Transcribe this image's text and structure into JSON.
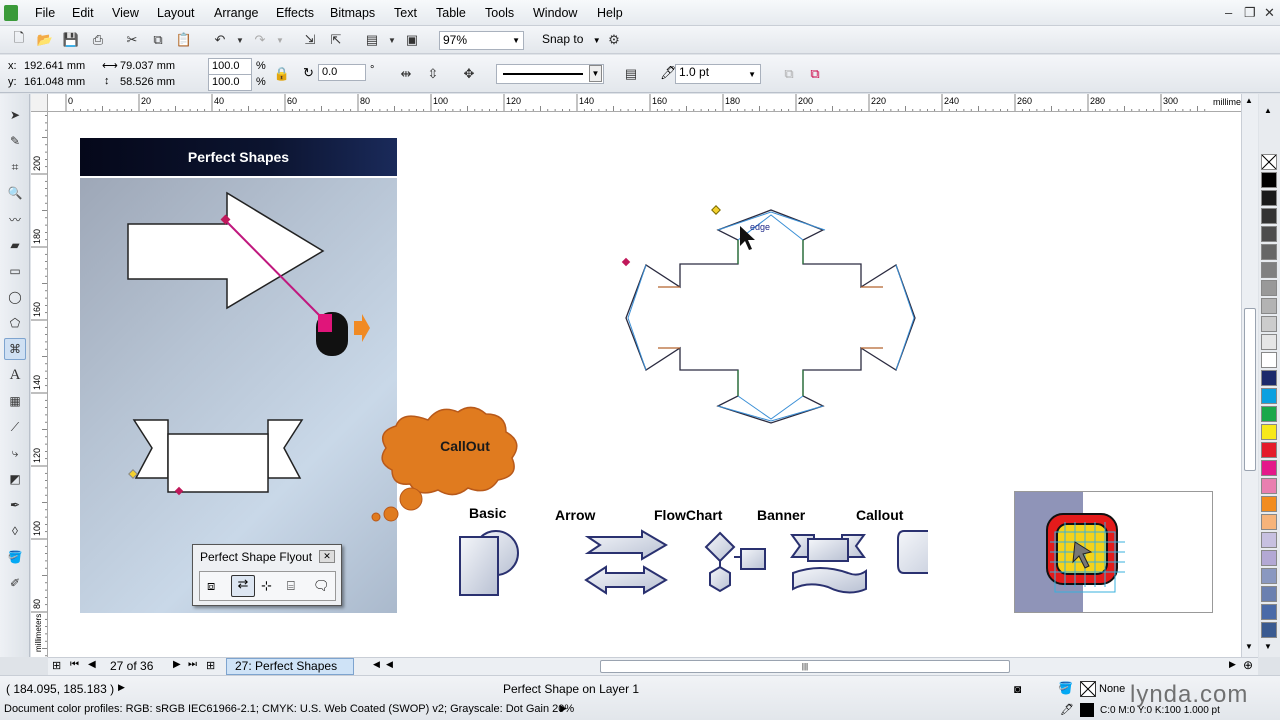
{
  "menu": {
    "items": [
      "File",
      "Edit",
      "View",
      "Layout",
      "Arrange",
      "Effects",
      "Bitmaps",
      "Text",
      "Table",
      "Tools",
      "Window",
      "Help"
    ]
  },
  "standard_toolbar": {
    "zoom": "97%",
    "snap_to": "Snap to"
  },
  "property_bar": {
    "x": "192.641 mm",
    "y": "161.048 mm",
    "width": "79.037 mm",
    "height": "58.526 mm",
    "scale_x": "100.0",
    "scale_y": "100.0",
    "percent": "%",
    "rotation": "0.0",
    "degree": "°",
    "outline_width": "1.0 pt",
    "x_label": "x:",
    "y_label": "y:"
  },
  "ruler": {
    "unit": "millimeters",
    "h_ticks": [
      "0",
      "20",
      "40",
      "60",
      "80",
      "100",
      "120",
      "140",
      "160",
      "180",
      "200",
      "220",
      "240",
      "260",
      "280",
      "300"
    ],
    "v_ticks": [
      "200",
      "180",
      "160",
      "140",
      "120",
      "100",
      "80"
    ]
  },
  "slide": {
    "title": "Perfect Shapes",
    "callout_text": "CallOut",
    "flyout_title": "Perfect Shape Flyout",
    "shape_labels": [
      "Basic",
      "Arrow",
      "FlowChart",
      "Banner",
      "Callout"
    ]
  },
  "canvas": {
    "edge_tooltip": "edge"
  },
  "pages": {
    "counter": "27 of 36",
    "current_tab": "27: Perfect Shapes"
  },
  "status": {
    "coordinates": "( 184.095, 185.183 )",
    "object_info": "Perfect Shape on Layer 1",
    "color_profiles": "Document color profiles: RGB: sRGB IEC61966-2.1; CMYK: U.S. Web Coated (SWOP) v2; Grayscale: Dot Gain 20%",
    "fill": "None",
    "outline": "C:0 M:0 Y:0 K:100  1.000 pt",
    "watermark": "lynda.com"
  },
  "colors": {
    "accent_orange": "#e07b1f",
    "dark_navy": "#0c1430",
    "selection_blue": "#3a8fd6"
  }
}
